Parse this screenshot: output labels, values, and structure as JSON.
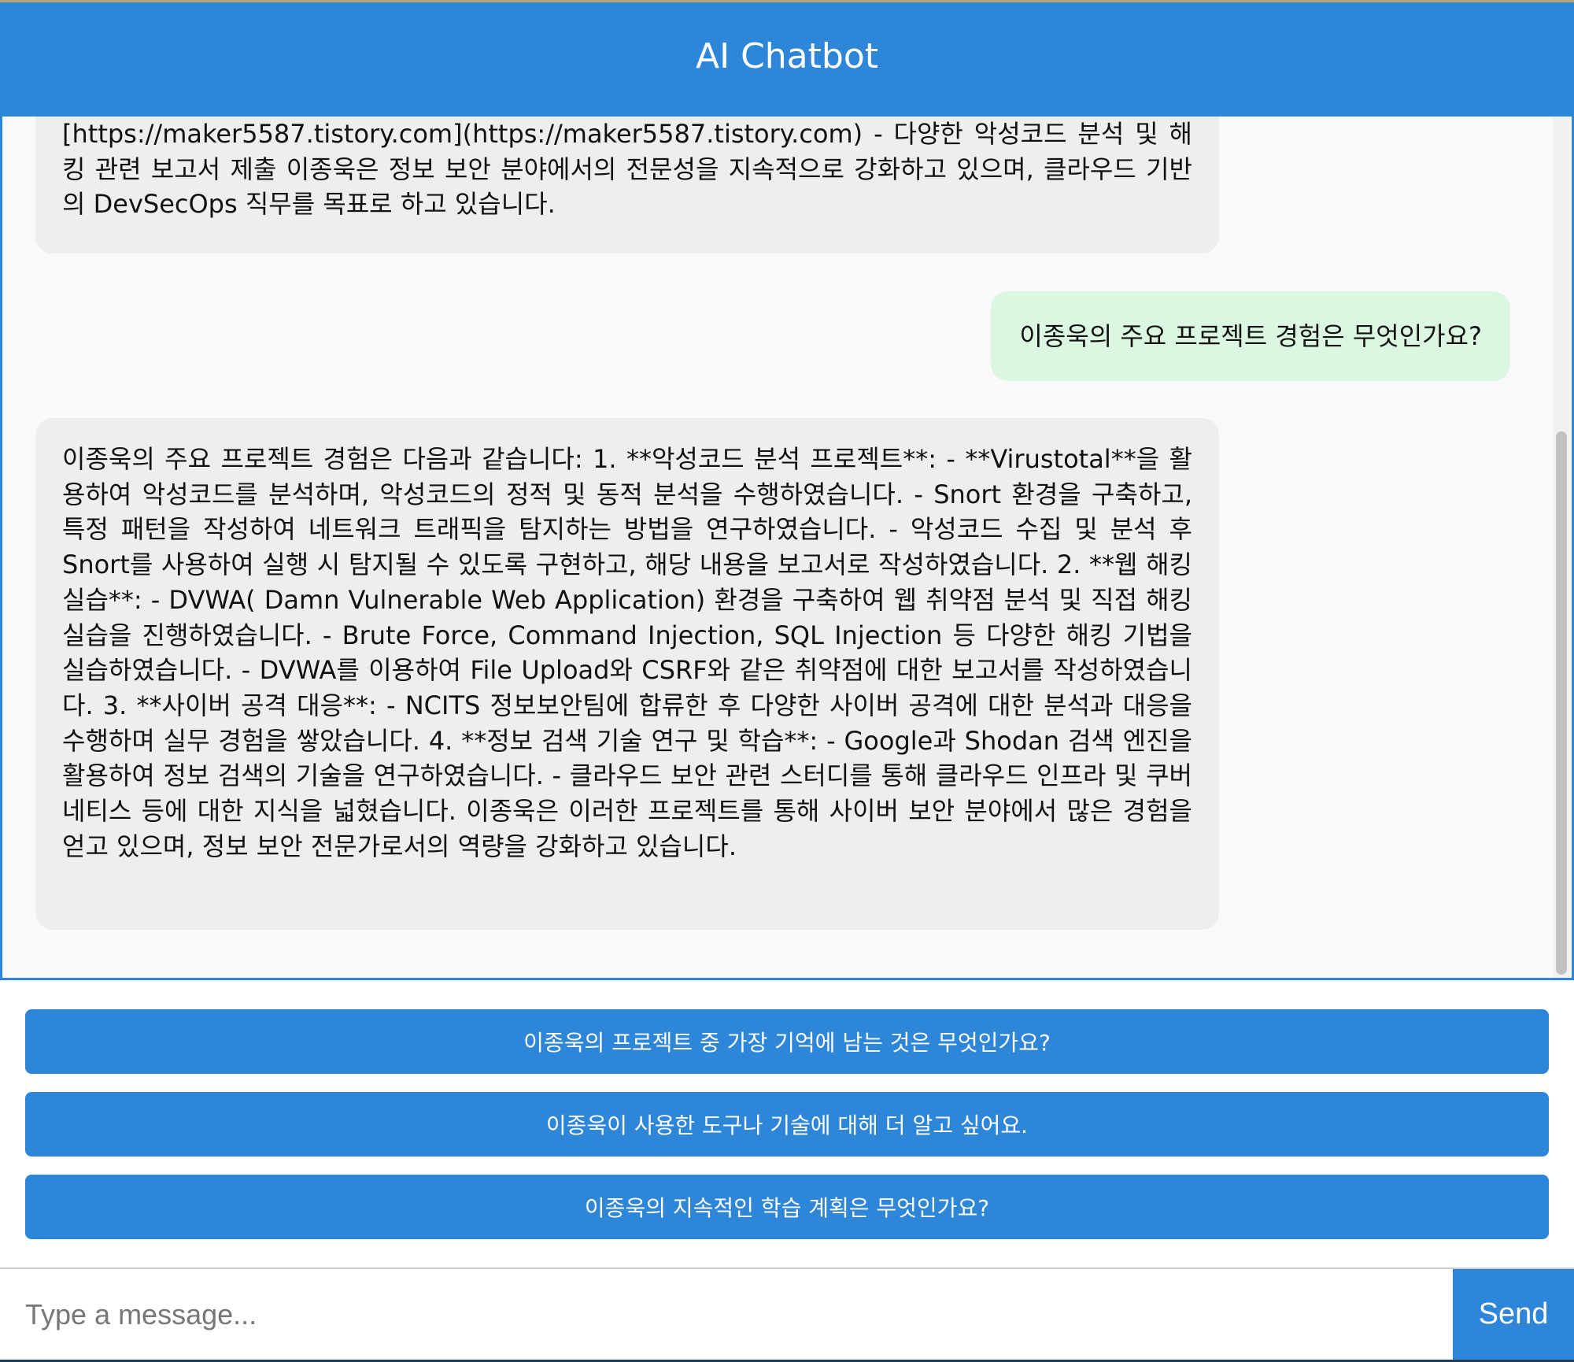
{
  "app": {
    "title": "AI Chatbot"
  },
  "messages": [
    {
      "role": "bot",
      "text": "[https://maker5587.tistory.com](https://maker5587.tistory.com) - 다양한 악성코드 분석 및 해킹 관련 보고서 제출 이종욱은 정보 보안 분야에서의 전문성을 지속적으로 강화하고 있으며, 클라우드 기반의 DevSecOps 직무를 목표로 하고 있습니다."
    },
    {
      "role": "user",
      "text": "이종욱의 주요 프로젝트 경험은 무엇인가요?"
    },
    {
      "role": "bot",
      "text": "이종욱의 주요 프로젝트 경험은 다음과 같습니다: 1. **악성코드 분석 프로젝트**: - **Virustotal**을 활용하여 악성코드를 분석하며, 악성코드의 정적 및 동적 분석을 수행하였습니다. - Snort 환경을 구축하고, 특정 패턴을 작성하여 네트워크 트래픽을 탐지하는 방법을 연구하였습니다. - 악성코드 수집 및 분석 후 Snort를 사용하여 실행 시 탐지될 수 있도록 구현하고, 해당 내용을 보고서로 작성하였습니다. 2. **웹 해킹 실습**: - DVWA( Damn Vulnerable Web Application) 환경을 구축하여 웹 취약점 분석 및 직접 해킹 실습을 진행하였습니다. - Brute Force, Command Injection, SQL Injection 등 다양한 해킹 기법을 실습하였습니다. - DVWA를 이용하여 File Upload와 CSRF와 같은 취약점에 대한 보고서를 작성하였습니다. 3. **사이버 공격 대응**: - NCITS 정보보안팀에 합류한 후 다양한 사이버 공격에 대한 분석과 대응을 수행하며 실무 경험을 쌓았습니다. 4. **정보 검색 기술 연구 및 학습**: - Google과 Shodan 검색 엔진을 활용하여 정보 검색의 기술을 연구하였습니다. - 클라우드 보안 관련 스터디를 통해 클라우드 인프라 및 쿠버네티스 등에 대한 지식을 넓혔습니다. 이종욱은 이러한 프로젝트를 통해 사이버 보안 분야에서 많은 경험을 얻고 있으며, 정보 보안 전문가로서의 역량을 강화하고 있습니다."
    }
  ],
  "suggestions": [
    "이종욱의 프로젝트 중 가장 기억에 남는 것은 무엇인가요?",
    "이종욱이 사용한 도구나 기술에 대해 더 알고 싶어요.",
    "이종욱의 지속적인 학습 계획은 무엇인가요?"
  ],
  "input": {
    "value": "",
    "placeholder": "Type a message..."
  },
  "send_label": "Send",
  "colors": {
    "accent": "#2e86d9",
    "bot_bubble": "#eeeeee",
    "user_bubble": "#dcf7e1"
  }
}
